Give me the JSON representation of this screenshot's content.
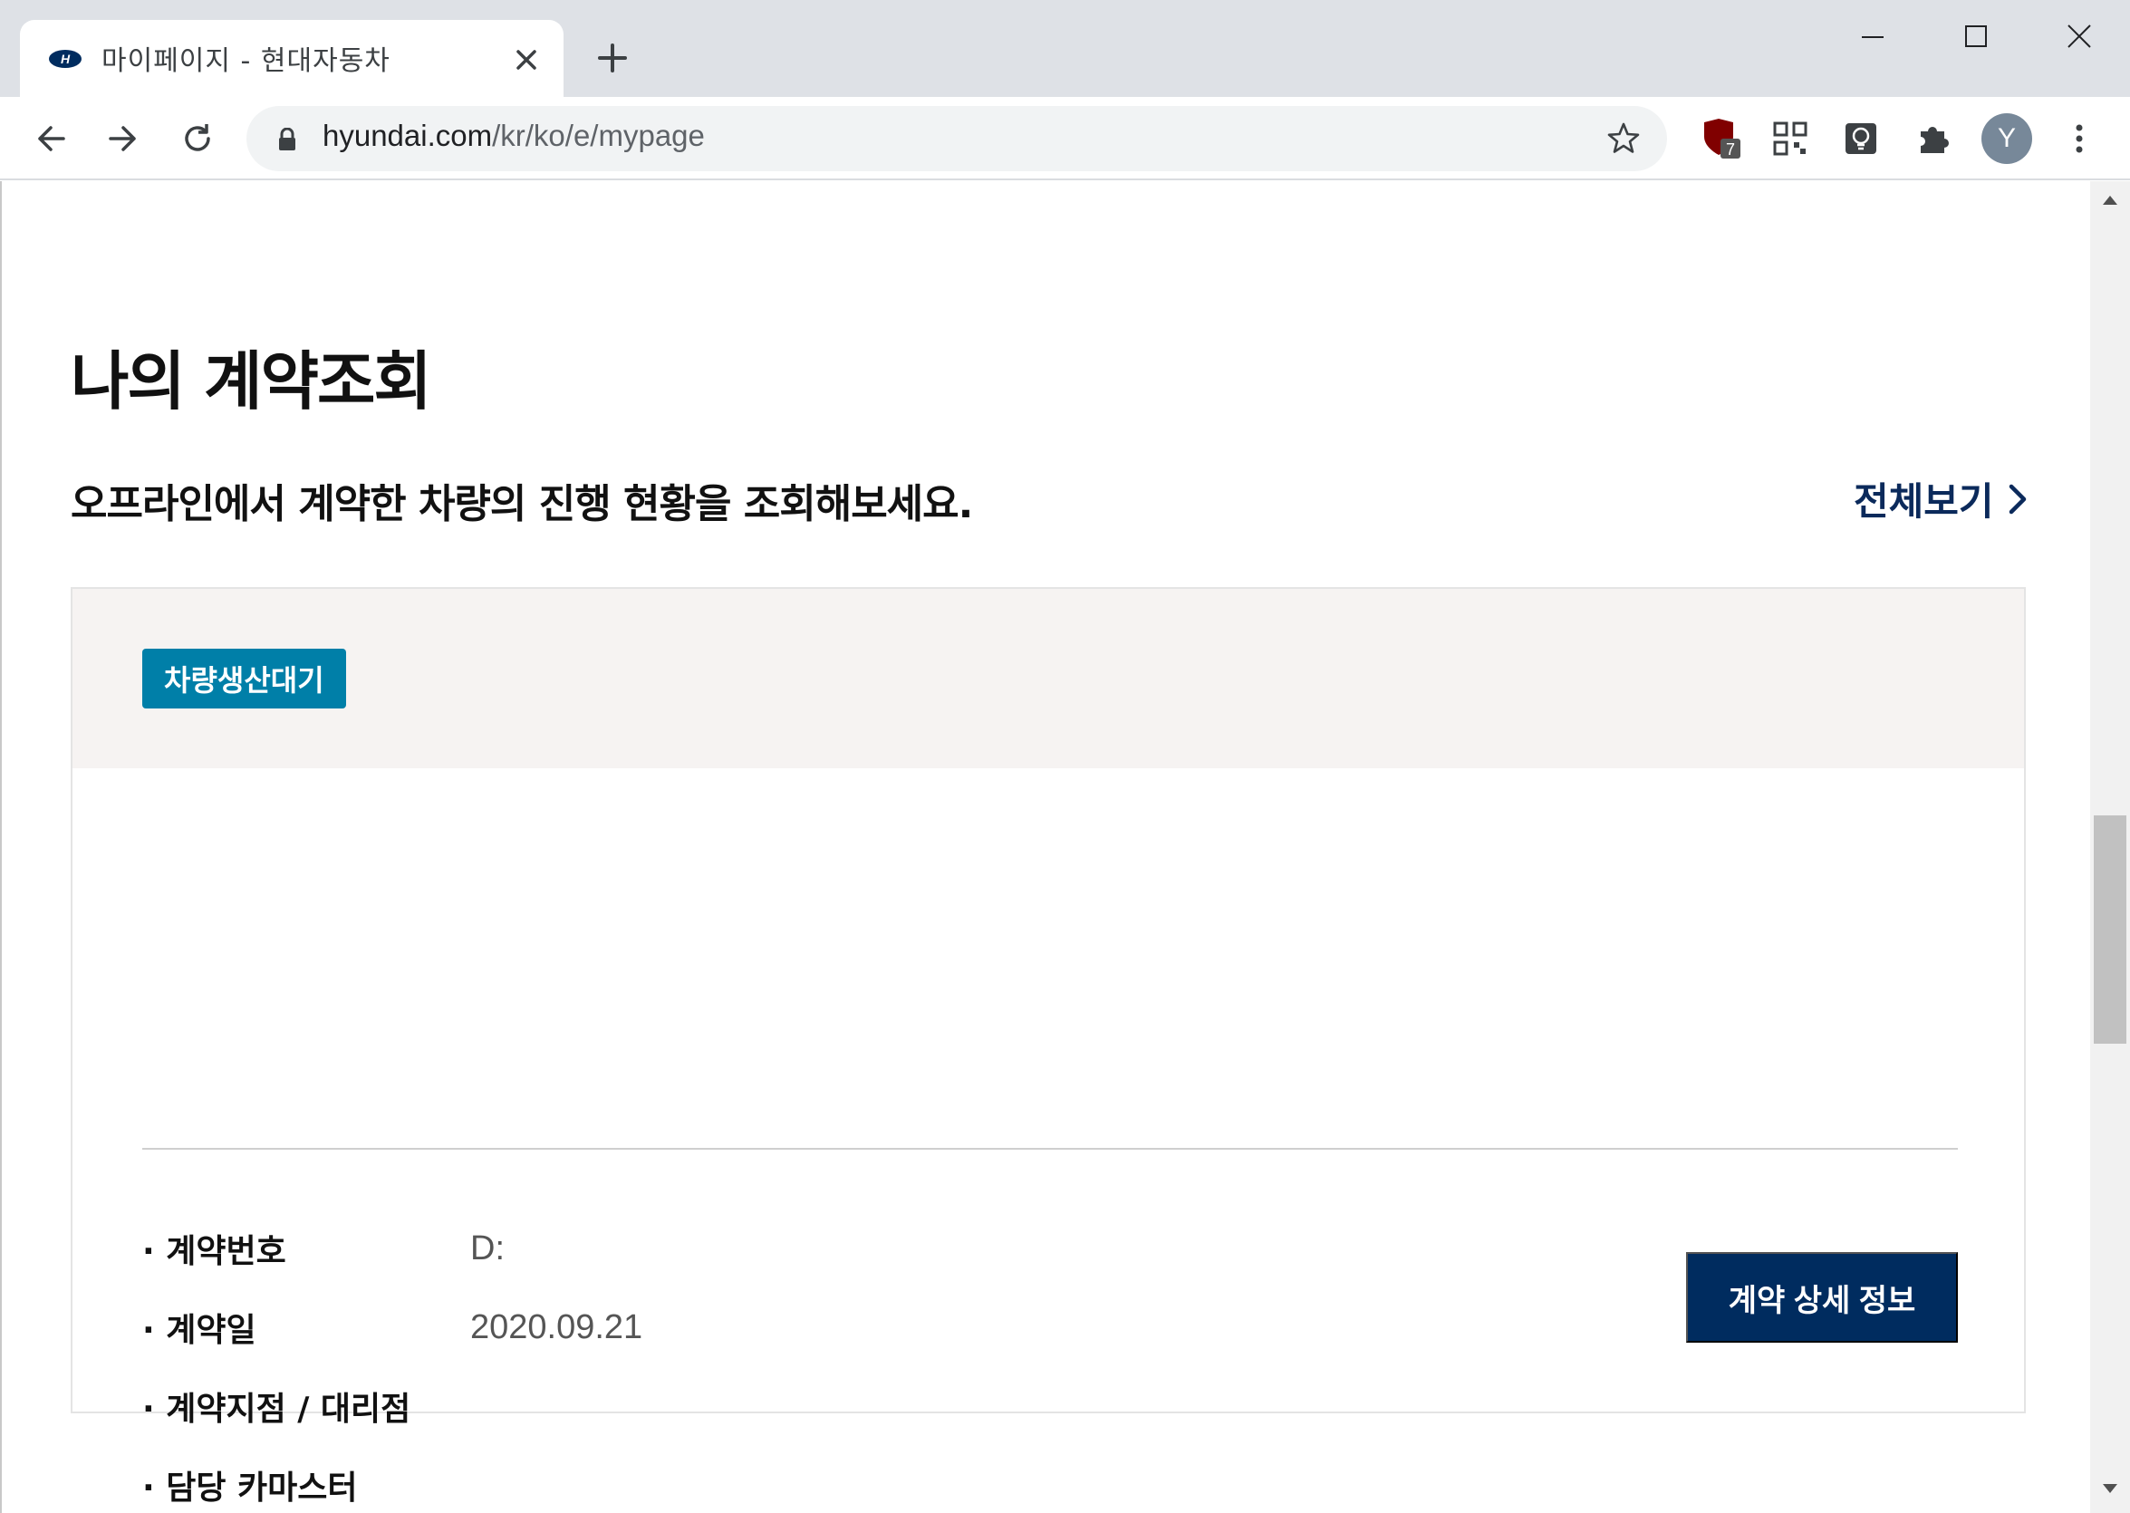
{
  "browser": {
    "tab_title": "마이페이지 - 현대자동차",
    "url_domain": "hyundai.com",
    "url_path": "/kr/ko/e/mypage",
    "extension_badge": "7",
    "profile_initial": "Y"
  },
  "page": {
    "title": "나의 계약조회",
    "subtitle": "오프라인에서 계약한 차량의 진행 현황을 조회해보세요.",
    "view_all_label": "전체보기"
  },
  "contract": {
    "status": "차량생산대기",
    "rows": [
      {
        "label": "· 계약번호",
        "value": "D:"
      },
      {
        "label": "· 계약일",
        "value": "2020.09.21"
      },
      {
        "label": "· 계약지점 / 대리점",
        "value": ""
      },
      {
        "label": "· 담당 카마스터",
        "value": ""
      }
    ],
    "detail_button": "계약 상세 정보"
  },
  "colors": {
    "status_badge": "#007fa8",
    "primary_navy": "#002c5f",
    "card_head_bg": "#f6f3f2"
  }
}
